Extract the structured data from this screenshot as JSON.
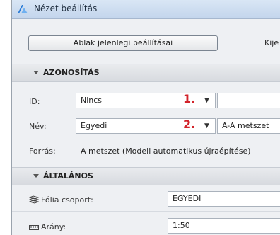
{
  "window": {
    "title": "Nézet beállítás"
  },
  "toolbar": {
    "current_settings_label": "Ablak jelenlegi beállításai",
    "second_button_partial": "Kije"
  },
  "sections": {
    "identification": "AZONOSÍTÁS",
    "general": "ÁLTALÁNOS"
  },
  "fields": {
    "id_label": "ID:",
    "id_value": "Nincs",
    "id_marker": "1.",
    "id_text_value": "",
    "name_label": "Név:",
    "name_value": "Egyedi",
    "name_marker": "2.",
    "name_text_value": "A-A metszet",
    "source_label": "Forrás:",
    "source_value": "A metszet (Modell automatikus újraépítése)",
    "layer_group_label": "Fólia csoport:",
    "layer_group_value": "EGYEDI",
    "scale_label": "Arány:",
    "scale_value": "1:50"
  },
  "icons": {
    "app": "archicad-icon",
    "dropdown": "dropdown-arrow-icon",
    "layers": "layers-icon",
    "scale": "ruler-icon"
  },
  "colors": {
    "marker": "#d2232a"
  }
}
